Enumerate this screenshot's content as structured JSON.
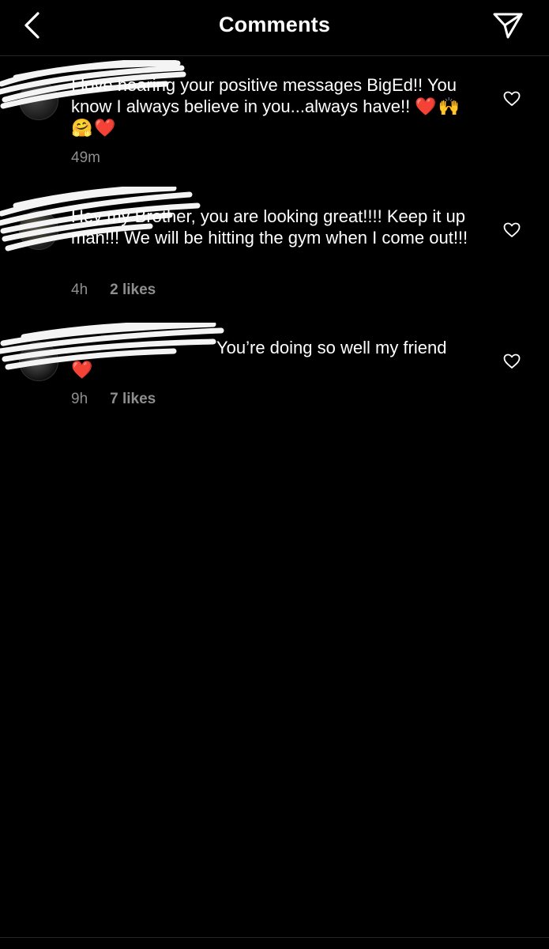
{
  "header": {
    "title": "Comments",
    "back_icon": "chevron-left-icon",
    "share_icon": "paper-plane-icon"
  },
  "comments": [
    {
      "username": "",
      "text": "I love hearing your positive messages BigEd!! You know I always believe in you...always have!! ",
      "emojis": "❤️🙌🤗❤️",
      "time": "49m",
      "likes": ""
    },
    {
      "username": "",
      "text": "Hey my Brother, you are looking great!!!! Keep it up man!!! We will be hitting the gym when I come out!!!",
      "emojis": "",
      "time": "4h",
      "likes": "2 likes"
    },
    {
      "username": "",
      "text": "You’re doing so well my friend ",
      "emojis": "❤️",
      "time": "9h",
      "likes": "7 likes"
    }
  ],
  "colors": {
    "background": "#000000",
    "text": "#ffffff",
    "secondary_text": "#8e8e8e",
    "heart_red": "#e0263d"
  }
}
